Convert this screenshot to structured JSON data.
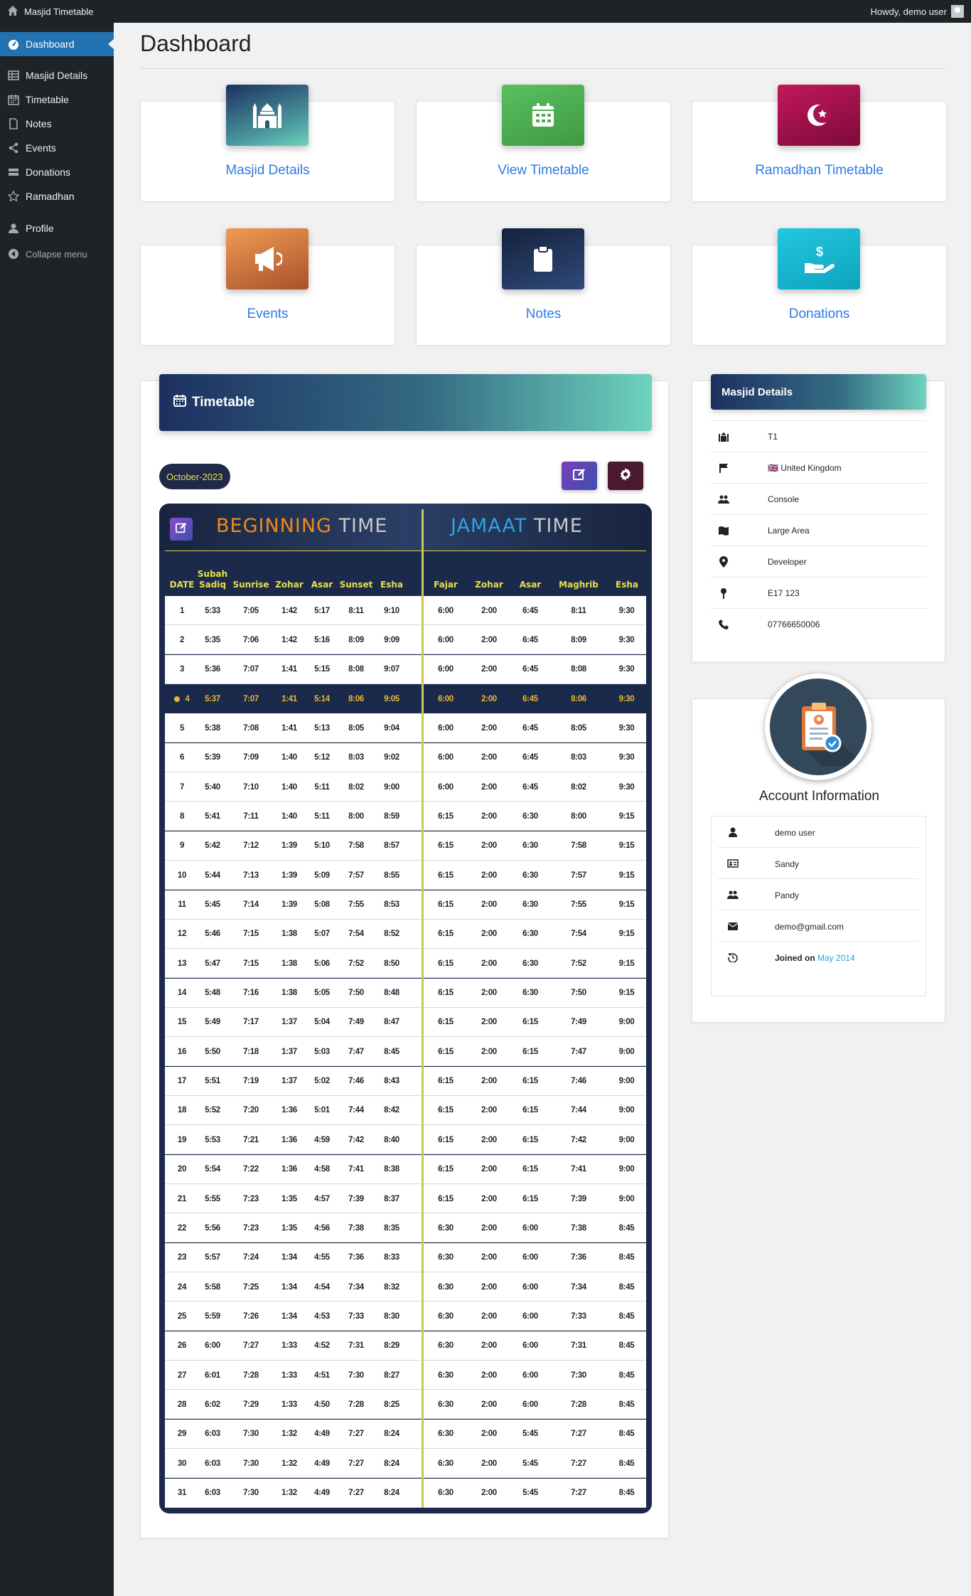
{
  "adminbar": {
    "site_title": "Masjid Timetable",
    "howdy": "Howdy, demo user"
  },
  "sidebar": {
    "items": [
      {
        "label": "Dashboard",
        "icon": "dashboard-icon"
      },
      {
        "label": "Masjid Details",
        "icon": "table-icon"
      },
      {
        "label": "Timetable",
        "icon": "calendar-icon"
      },
      {
        "label": "Notes",
        "icon": "note-icon"
      },
      {
        "label": "Events",
        "icon": "share-icon"
      },
      {
        "label": "Donations",
        "icon": "donations-icon"
      },
      {
        "label": "Ramadhan",
        "icon": "star-icon"
      },
      {
        "label": "Profile",
        "icon": "user-icon"
      },
      {
        "label": "Collapse menu",
        "icon": "collapse-icon"
      }
    ]
  },
  "page": {
    "title": "Dashboard"
  },
  "cards": [
    {
      "label": "Masjid Details",
      "icon": "mosque-icon",
      "color": "#1f3a5f"
    },
    {
      "label": "View Timetable",
      "icon": "calendar-icon",
      "color": "#43a047"
    },
    {
      "label": "Ramadhan Timetable",
      "icon": "crescent-star-icon",
      "color": "#a0104e"
    },
    {
      "label": "Events",
      "icon": "megaphone-icon",
      "color": "#e07a3a"
    },
    {
      "label": "Notes",
      "icon": "clipboard-icon",
      "color": "#1d2d4f"
    },
    {
      "label": "Donations",
      "icon": "donate-hand-icon",
      "color": "#17b7d3"
    }
  ],
  "timetable": {
    "title": "Timetable",
    "month": "October-2023",
    "beginning": {
      "word1": "BEGINNING",
      "word2": "TIME"
    },
    "jamaat": {
      "word1": "JAMAAT",
      "word2": "TIME"
    },
    "headers": [
      "DATE",
      "Subah Sadiq",
      "Sunrise",
      "Zohar",
      "Asar",
      "Sunset",
      "Esha",
      "Fajar",
      "Zohar",
      "Asar",
      "Maghrib",
      "Esha"
    ],
    "today_index": 3,
    "rows": [
      [
        "1",
        "5:33",
        "7:05",
        "1:42",
        "5:17",
        "8:11",
        "9:10",
        "6:00",
        "2:00",
        "6:45",
        "8:11",
        "9:30"
      ],
      [
        "2",
        "5:35",
        "7:06",
        "1:42",
        "5:16",
        "8:09",
        "9:09",
        "6:00",
        "2:00",
        "6:45",
        "8:09",
        "9:30"
      ],
      [
        "3",
        "5:36",
        "7:07",
        "1:41",
        "5:15",
        "8:08",
        "9:07",
        "6:00",
        "2:00",
        "6:45",
        "8:08",
        "9:30"
      ],
      [
        "4",
        "5:37",
        "7:07",
        "1:41",
        "5:14",
        "8:06",
        "9:05",
        "6:00",
        "2:00",
        "6:45",
        "8:06",
        "9:30"
      ],
      [
        "5",
        "5:38",
        "7:08",
        "1:41",
        "5:13",
        "8:05",
        "9:04",
        "6:00",
        "2:00",
        "6:45",
        "8:05",
        "9:30"
      ],
      [
        "6",
        "5:39",
        "7:09",
        "1:40",
        "5:12",
        "8:03",
        "9:02",
        "6:00",
        "2:00",
        "6:45",
        "8:03",
        "9:30"
      ],
      [
        "7",
        "5:40",
        "7:10",
        "1:40",
        "5:11",
        "8:02",
        "9:00",
        "6:00",
        "2:00",
        "6:45",
        "8:02",
        "9:30"
      ],
      [
        "8",
        "5:41",
        "7:11",
        "1:40",
        "5:11",
        "8:00",
        "8:59",
        "6:15",
        "2:00",
        "6:30",
        "8:00",
        "9:15"
      ],
      [
        "9",
        "5:42",
        "7:12",
        "1:39",
        "5:10",
        "7:58",
        "8:57",
        "6:15",
        "2:00",
        "6:30",
        "7:58",
        "9:15"
      ],
      [
        "10",
        "5:44",
        "7:13",
        "1:39",
        "5:09",
        "7:57",
        "8:55",
        "6:15",
        "2:00",
        "6:30",
        "7:57",
        "9:15"
      ],
      [
        "11",
        "5:45",
        "7:14",
        "1:39",
        "5:08",
        "7:55",
        "8:53",
        "6:15",
        "2:00",
        "6:30",
        "7:55",
        "9:15"
      ],
      [
        "12",
        "5:46",
        "7:15",
        "1:38",
        "5:07",
        "7:54",
        "8:52",
        "6:15",
        "2:00",
        "6:30",
        "7:54",
        "9:15"
      ],
      [
        "13",
        "5:47",
        "7:15",
        "1:38",
        "5:06",
        "7:52",
        "8:50",
        "6:15",
        "2:00",
        "6:30",
        "7:52",
        "9:15"
      ],
      [
        "14",
        "5:48",
        "7:16",
        "1:38",
        "5:05",
        "7:50",
        "8:48",
        "6:15",
        "2:00",
        "6:30",
        "7:50",
        "9:15"
      ],
      [
        "15",
        "5:49",
        "7:17",
        "1:37",
        "5:04",
        "7:49",
        "8:47",
        "6:15",
        "2:00",
        "6:15",
        "7:49",
        "9:00"
      ],
      [
        "16",
        "5:50",
        "7:18",
        "1:37",
        "5:03",
        "7:47",
        "8:45",
        "6:15",
        "2:00",
        "6:15",
        "7:47",
        "9:00"
      ],
      [
        "17",
        "5:51",
        "7:19",
        "1:37",
        "5:02",
        "7:46",
        "8:43",
        "6:15",
        "2:00",
        "6:15",
        "7:46",
        "9:00"
      ],
      [
        "18",
        "5:52",
        "7:20",
        "1:36",
        "5:01",
        "7:44",
        "8:42",
        "6:15",
        "2:00",
        "6:15",
        "7:44",
        "9:00"
      ],
      [
        "19",
        "5:53",
        "7:21",
        "1:36",
        "4:59",
        "7:42",
        "8:40",
        "6:15",
        "2:00",
        "6:15",
        "7:42",
        "9:00"
      ],
      [
        "20",
        "5:54",
        "7:22",
        "1:36",
        "4:58",
        "7:41",
        "8:38",
        "6:15",
        "2:00",
        "6:15",
        "7:41",
        "9:00"
      ],
      [
        "21",
        "5:55",
        "7:23",
        "1:35",
        "4:57",
        "7:39",
        "8:37",
        "6:15",
        "2:00",
        "6:15",
        "7:39",
        "9:00"
      ],
      [
        "22",
        "5:56",
        "7:23",
        "1:35",
        "4:56",
        "7:38",
        "8:35",
        "6:30",
        "2:00",
        "6:00",
        "7:38",
        "8:45"
      ],
      [
        "23",
        "5:57",
        "7:24",
        "1:34",
        "4:55",
        "7:36",
        "8:33",
        "6:30",
        "2:00",
        "6:00",
        "7:36",
        "8:45"
      ],
      [
        "24",
        "5:58",
        "7:25",
        "1:34",
        "4:54",
        "7:34",
        "8:32",
        "6:30",
        "2:00",
        "6:00",
        "7:34",
        "8:45"
      ],
      [
        "25",
        "5:59",
        "7:26",
        "1:34",
        "4:53",
        "7:33",
        "8:30",
        "6:30",
        "2:00",
        "6:00",
        "7:33",
        "8:45"
      ],
      [
        "26",
        "6:00",
        "7:27",
        "1:33",
        "4:52",
        "7:31",
        "8:29",
        "6:30",
        "2:00",
        "6:00",
        "7:31",
        "8:45"
      ],
      [
        "27",
        "6:01",
        "7:28",
        "1:33",
        "4:51",
        "7:30",
        "8:27",
        "6:30",
        "2:00",
        "6:00",
        "7:30",
        "8:45"
      ],
      [
        "28",
        "6:02",
        "7:29",
        "1:33",
        "4:50",
        "7:28",
        "8:25",
        "6:30",
        "2:00",
        "6:00",
        "7:28",
        "8:45"
      ],
      [
        "29",
        "6:03",
        "7:30",
        "1:32",
        "4:49",
        "7:27",
        "8:24",
        "6:30",
        "2:00",
        "5:45",
        "7:27",
        "8:45"
      ],
      [
        "30",
        "6:03",
        "7:30",
        "1:32",
        "4:49",
        "7:27",
        "8:24",
        "6:30",
        "2:00",
        "5:45",
        "7:27",
        "8:45"
      ],
      [
        "31",
        "6:03",
        "7:30",
        "1:32",
        "4:49",
        "7:27",
        "8:24",
        "6:30",
        "2:00",
        "5:45",
        "7:27",
        "8:45"
      ]
    ]
  },
  "masjid_details": {
    "title": "Masjid Details",
    "rows": [
      {
        "icon": "mosque-icon",
        "value": "T1"
      },
      {
        "icon": "flag-icon",
        "value": "🇬🇧 United Kingdom"
      },
      {
        "icon": "users-icon",
        "value": "Console"
      },
      {
        "icon": "map-icon",
        "value": "Large Area"
      },
      {
        "icon": "map-pin-icon",
        "value": "Developer"
      },
      {
        "icon": "pushpin-icon",
        "value": "E17 123"
      },
      {
        "icon": "phone-icon",
        "value": "07766650006"
      }
    ]
  },
  "account": {
    "title": "Account Information",
    "username": "demo user",
    "first_name": "Sandy",
    "last_name": "Pandy",
    "email": "demo@gmail.com",
    "joined_label": "Joined on",
    "joined_value": "May 2014"
  }
}
